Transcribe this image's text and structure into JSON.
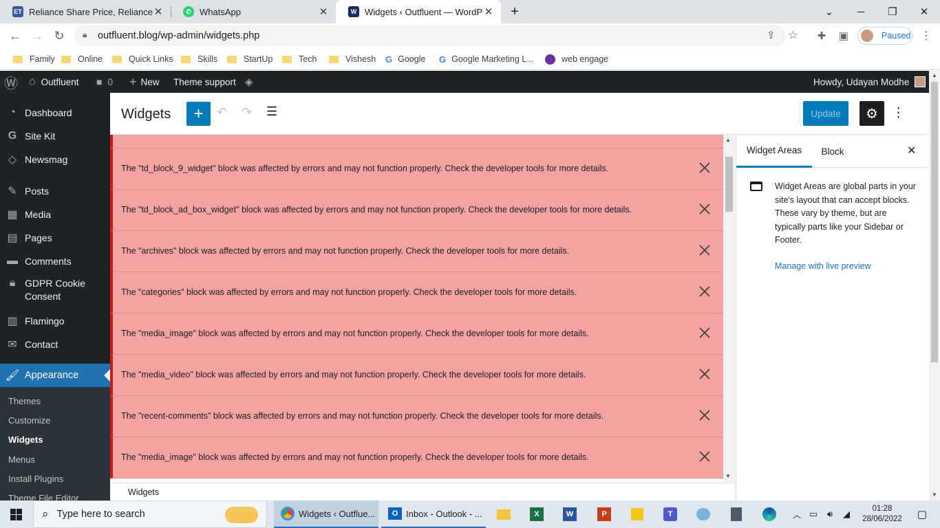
{
  "browser": {
    "tabs": [
      {
        "title": "Reliance Share Price, Reliance Sto",
        "icon": "economic-times-favicon",
        "active": false
      },
      {
        "title": "WhatsApp",
        "icon": "whatsapp-favicon",
        "active": false
      },
      {
        "title": "Widgets ‹ Outfluent — WordPres",
        "icon": "wordpress-favicon",
        "active": true
      }
    ],
    "url": "outfluent.blog/wp-admin/widgets.php",
    "profile_status": "Paused",
    "bookmarks": [
      {
        "label": "Family",
        "icon": "folder-icon"
      },
      {
        "label": "Online",
        "icon": "folder-icon"
      },
      {
        "label": "Quick Links",
        "icon": "folder-icon"
      },
      {
        "label": "Skills",
        "icon": "folder-icon"
      },
      {
        "label": "StartUp",
        "icon": "folder-icon"
      },
      {
        "label": "Tech",
        "icon": "folder-icon"
      },
      {
        "label": "Vishesh",
        "icon": "folder-icon"
      },
      {
        "label": "Google",
        "icon": "google-icon"
      },
      {
        "label": "Google Marketing L...",
        "icon": "google-icon"
      },
      {
        "label": "web engage",
        "icon": "webengage-icon"
      }
    ]
  },
  "adminbar": {
    "site_name": "Outfluent",
    "comments_count": "0",
    "new_label": "New",
    "theme_support": "Theme support",
    "greeting": "Howdy, Udayan Modhe"
  },
  "sidebar": {
    "items": [
      {
        "label": "Dashboard",
        "icon": "dashboard-icon"
      },
      {
        "label": "Site Kit",
        "icon": "google-g-icon"
      },
      {
        "label": "Newsmag",
        "icon": "newsmag-icon"
      },
      {
        "label": "Posts",
        "icon": "pin-icon"
      },
      {
        "label": "Media",
        "icon": "media-icon"
      },
      {
        "label": "Pages",
        "icon": "pages-icon"
      },
      {
        "label": "Comments",
        "icon": "comment-icon"
      },
      {
        "label": "GDPR Cookie Consent",
        "icon": "lock-icon"
      },
      {
        "label": "Flamingo",
        "icon": "flamingo-icon"
      },
      {
        "label": "Contact",
        "icon": "mail-icon"
      },
      {
        "label": "Appearance",
        "icon": "brush-icon"
      }
    ],
    "submenu": [
      "Themes",
      "Customize",
      "Widgets",
      "Menus",
      "Install Plugins",
      "Theme File Editor"
    ],
    "submenu_active": "Widgets"
  },
  "editor": {
    "title": "Widgets",
    "update_label": "Update",
    "footer_breadcrumb": "Widgets",
    "notices": [
      "The \"td_block_9_widget\" block was affected by errors and may not function properly. Check the developer tools for more details.",
      "The \"td_block_ad_box_widget\" block was affected by errors and may not function properly. Check the developer tools for more details.",
      "The \"archives\" block was affected by errors and may not function properly. Check the developer tools for more details.",
      "The \"categories\" block was affected by errors and may not function properly. Check the developer tools for more details.",
      "The \"media_image\" block was affected by errors and may not function properly. Check the developer tools for more details.",
      "The \"media_video\" block was affected by errors and may not function properly. Check the developer tools for more details.",
      "The \"recent-comments\" block was affected by errors and may not function properly. Check the developer tools for more details.",
      "The \"media_image\" block was affected by errors and may not function properly. Check the developer tools for more details."
    ]
  },
  "panel": {
    "tabs": [
      "Widget Areas",
      "Block"
    ],
    "active_tab": "Widget Areas",
    "description": "Widget Areas are global parts in your site's layout that can accept blocks. These vary by theme, but are typically parts like your Sidebar or Footer.",
    "link": "Manage with live preview"
  },
  "taskbar": {
    "search_placeholder": "Type here to search",
    "apps": [
      {
        "label": "Widgets ‹ Outflue...",
        "icon": "chrome-icon"
      },
      {
        "label": "Inbox - Outlook - ...",
        "icon": "outlook-icon"
      }
    ],
    "time": "01:28",
    "date": "28/06/2022"
  },
  "colors": {
    "wp_blue": "#2271b1",
    "button_blue": "#007cba",
    "notice_bg": "#f4a2a2",
    "notice_border": "#cc1818",
    "admin_dark": "#1d2327"
  }
}
